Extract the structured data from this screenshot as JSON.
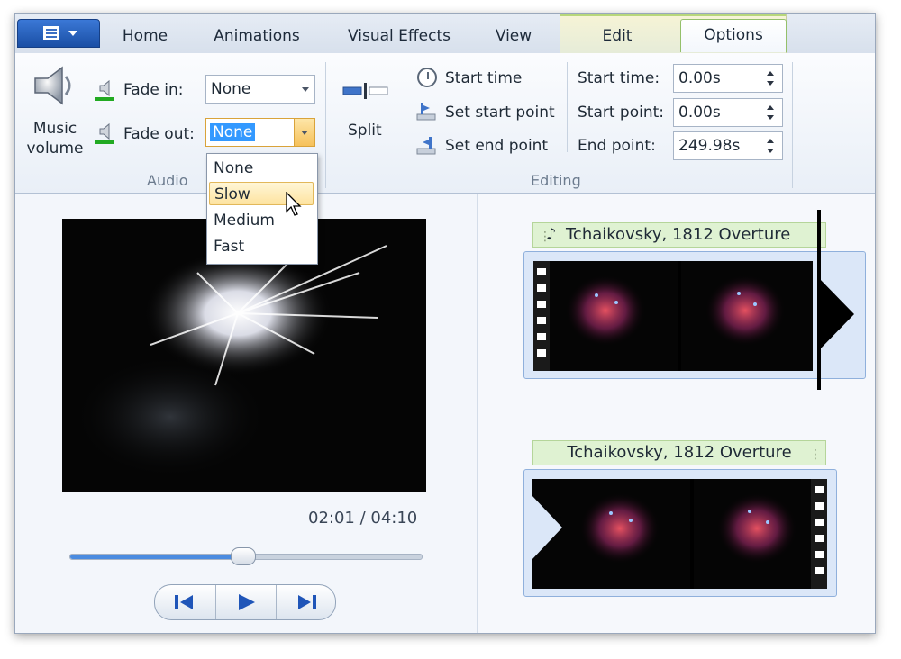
{
  "tabs": [
    {
      "label": "Home"
    },
    {
      "label": "Animations"
    },
    {
      "label": "Visual Effects"
    },
    {
      "label": "View"
    },
    {
      "label": "Edit"
    },
    {
      "label": "Options"
    }
  ],
  "ribbon": {
    "audio": {
      "group_label": "Audio",
      "music_volume_line1": "Music",
      "music_volume_line2": "volume",
      "fade_in_label": "Fade in:",
      "fade_in_value": "None",
      "fade_out_label": "Fade out:",
      "fade_out_value": "None",
      "fade_out_options": [
        "None",
        "Slow",
        "Medium",
        "Fast"
      ],
      "highlighted_option": "Slow"
    },
    "split_label": "Split",
    "editing": {
      "group_label": "Editing",
      "start_time_button": "Start time",
      "set_start_point_button": "Set start point",
      "set_end_point_button": "Set end point",
      "start_time_label": "Start time:",
      "start_time_value": "0.00s",
      "start_point_label": "Start point:",
      "start_point_value": "0.00s",
      "end_point_label": "End point:",
      "end_point_value": "249.98s"
    }
  },
  "preview": {
    "time_display": "02:01 / 04:10",
    "progress": 0.49
  },
  "storyboard": {
    "clip1_caption": "Tchaikovsky, 1812 Overture",
    "clip2_caption": "Tchaikovsky, 1812 Overture"
  },
  "colors": {
    "accent_blue": "#2a62c4",
    "context_tab_green": "#94c06a",
    "caption_green": "#dff2d2",
    "selection_blue": "#3399ff"
  }
}
